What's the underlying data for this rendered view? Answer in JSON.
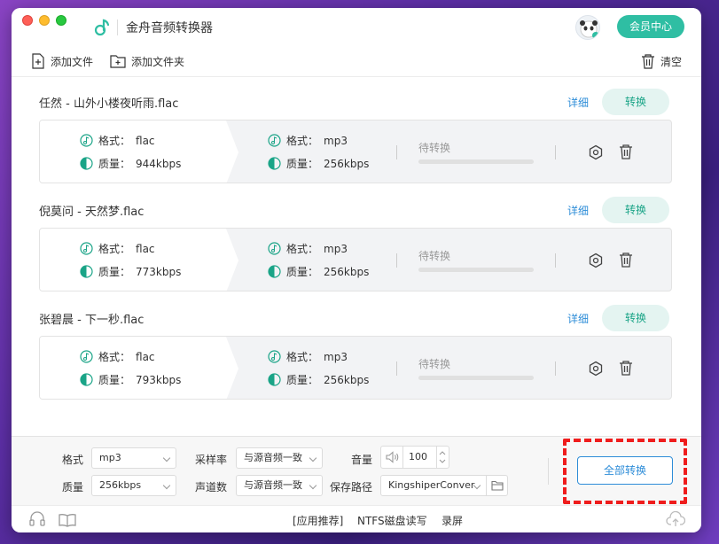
{
  "app": {
    "title": "金舟音频转换器",
    "vip_label": "会员中心"
  },
  "toolbar": {
    "add_file": "添加文件",
    "add_folder": "添加文件夹",
    "clear": "清空"
  },
  "labels": {
    "detail": "详细",
    "convert": "转换",
    "format_prefix": "格式：",
    "quality_prefix": "质量：",
    "pending": "待转换"
  },
  "files": [
    {
      "name": "任然 - 山外小楼夜听雨.flac",
      "src_format": "flac",
      "src_quality": "944kbps",
      "dst_format": "mp3",
      "dst_quality": "256kbps",
      "progress": 0
    },
    {
      "name": "倪莫问 - 天然梦.flac",
      "src_format": "flac",
      "src_quality": "773kbps",
      "dst_format": "mp3",
      "dst_quality": "256kbps",
      "progress": 0
    },
    {
      "name": "张碧晨 - 下一秒.flac",
      "src_format": "flac",
      "src_quality": "793kbps",
      "dst_format": "mp3",
      "dst_quality": "256kbps",
      "progress": 0
    }
  ],
  "settings": {
    "format_label": "格式",
    "format_value": "mp3",
    "quality_label": "质量",
    "quality_value": "256kbps",
    "samplerate_label": "采样率",
    "samplerate_value": "与源音频一致",
    "channels_label": "声道数",
    "channels_value": "与源音频一致",
    "volume_label": "音量",
    "volume_value": "100",
    "savepath_label": "保存路径",
    "savepath_value": "KingshiperConver",
    "convert_all": "全部转换"
  },
  "statusbar": {
    "recommend": "[应用推荐]",
    "ntfs": "NTFS磁盘读写",
    "record": "录屏"
  },
  "colors": {
    "accent": "#2fbea3",
    "link": "#2e8dd8",
    "highlight": "#ef1d1d"
  }
}
